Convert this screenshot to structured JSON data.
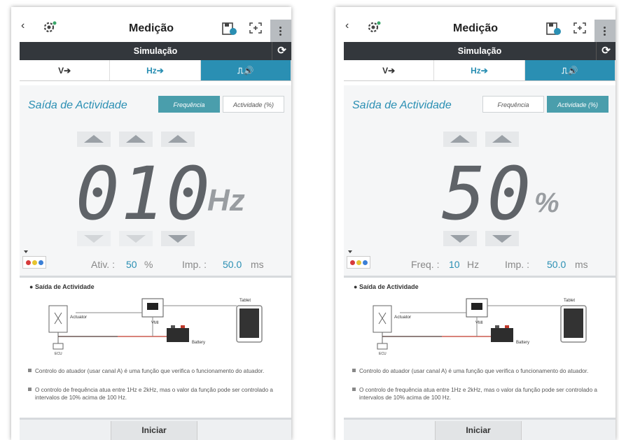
{
  "left": {
    "header": {
      "title": "Medição",
      "icons": [
        "back-icon",
        "settings-icon",
        "save-icon",
        "capture-icon",
        "more-icon"
      ]
    },
    "subheader": {
      "title": "Simulação",
      "refresh_icon": "refresh-icon"
    },
    "tabs": [
      {
        "label": "V➔",
        "active": false
      },
      {
        "label": "Hz➔",
        "active": false
      },
      {
        "label": "⎍🔊",
        "active": true
      }
    ],
    "section_title": "Saída de Actividade",
    "toggles": {
      "frequency": "Frequência",
      "activity": "Actividade (%)",
      "selected": "frequency"
    },
    "display": {
      "value": "010",
      "unit": "Hz"
    },
    "info": {
      "label1": "Ativ. :",
      "value1": "50",
      "unit1": "%",
      "label2": "Imp. :",
      "value2": "50.0",
      "unit2": "ms"
    },
    "diagram": {
      "title": "Saída de Actividade",
      "labels": {
        "actuator": "Actuator",
        "vmi": "VMI",
        "tablet": "Tablet",
        "battery": "Battery",
        "ecu": "ECU"
      },
      "notes": [
        "Controlo do atuador (usar canal A) é uma função que verifica o funcionamento do atuador.",
        "O controlo de frequência atua entre 1Hz e 2kHz, mas o valor da função pode ser controlado a intervalos de 10% acima de 100 Hz."
      ]
    },
    "start_button": "Iniciar"
  },
  "right": {
    "header": {
      "title": "Medição",
      "icons": [
        "back-icon",
        "settings-icon",
        "save-icon",
        "capture-icon",
        "more-icon"
      ]
    },
    "subheader": {
      "title": "Simulação",
      "refresh_icon": "refresh-icon"
    },
    "tabs": [
      {
        "label": "V➔",
        "active": false
      },
      {
        "label": "Hz➔",
        "active": false
      },
      {
        "label": "⎍🔊",
        "active": true
      }
    ],
    "section_title": "Saída de Actividade",
    "toggles": {
      "frequency": "Frequência",
      "activity": "Actividade (%)",
      "selected": "activity"
    },
    "display": {
      "value": "50",
      "unit": "%"
    },
    "info": {
      "label1": "Freq. :",
      "value1": "10",
      "unit1": "Hz",
      "label2": "Imp. :",
      "value2": "50.0",
      "unit2": "ms"
    },
    "diagram": {
      "title": "Saída de Actividade",
      "labels": {
        "actuator": "Actuator",
        "vmi": "VMI",
        "tablet": "Tablet",
        "battery": "Battery",
        "ecu": "ECU"
      },
      "notes": [
        "Controlo do atuador (usar canal A) é uma função que verifica o funcionamento do atuador.",
        "O controlo de frequência atua entre 1Hz e 2kHz, mas o valor da função pode ser controlado a intervalos de 10% acima de 100 Hz."
      ]
    },
    "start_button": "Iniciar"
  },
  "colors": {
    "accent": "#2a8fb3",
    "toggle_selected": "#4a9eac",
    "dark_bar": "#33373c",
    "digit": "#5f6368"
  }
}
